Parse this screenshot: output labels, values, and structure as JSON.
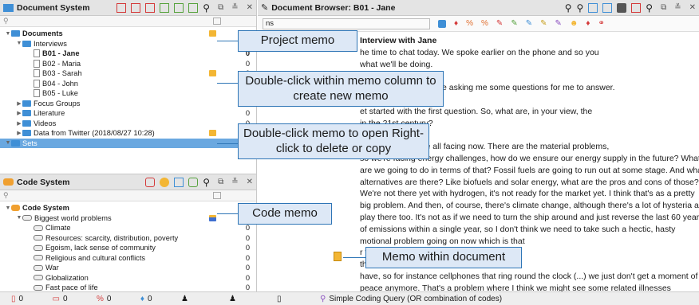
{
  "document_system": {
    "title": "Document System",
    "tree": [
      {
        "label": "Documents",
        "bold": true,
        "level": 0,
        "icon": "folder",
        "memo": true
      },
      {
        "label": "Interviews",
        "level": 1,
        "icon": "folder"
      },
      {
        "label": "B01 - Jane",
        "level": 2,
        "icon": "doc",
        "bold": true,
        "count": "0"
      },
      {
        "label": "B02 - Maria",
        "level": 2,
        "icon": "doc",
        "count": "0"
      },
      {
        "label": "B03 - Sarah",
        "level": 2,
        "icon": "doc",
        "count": "0",
        "memo": true
      },
      {
        "label": "B04 - John",
        "level": 2,
        "icon": "doc",
        "count": "0"
      },
      {
        "label": "B05 - Luke",
        "level": 2,
        "icon": "doc",
        "count": "0"
      },
      {
        "label": "Focus Groups",
        "level": 1,
        "icon": "folder",
        "count": "0"
      },
      {
        "label": "Literature",
        "level": 1,
        "icon": "folder",
        "count": "0"
      },
      {
        "label": "Videos",
        "level": 1,
        "icon": "folder",
        "count": "0"
      },
      {
        "label": "Data from Twitter (2018/08/27 10:28)",
        "level": 1,
        "icon": "folder",
        "count": "0",
        "memo": true
      },
      {
        "label": "Sets",
        "level": 0,
        "icon": "folder",
        "selected": true,
        "count": "0"
      }
    ]
  },
  "code_system": {
    "title": "Code System",
    "tree": [
      {
        "label": "Code System",
        "bold": true,
        "level": 0,
        "icon": "folder"
      },
      {
        "label": "Biggest world problems",
        "level": 1,
        "icon": "code",
        "memo": true
      },
      {
        "label": "Climate",
        "level": 2,
        "icon": "code",
        "count": "0"
      },
      {
        "label": "Resources: scarcity, distribution, poverty",
        "level": 2,
        "icon": "code",
        "count": "0"
      },
      {
        "label": "Egoism, lack sense of community",
        "level": 2,
        "icon": "code",
        "count": "0"
      },
      {
        "label": "Religious and cultural conflicts",
        "level": 2,
        "icon": "code",
        "count": "0"
      },
      {
        "label": "War",
        "level": 2,
        "icon": "code",
        "count": "0"
      },
      {
        "label": "Globalization",
        "level": 2,
        "icon": "code",
        "count": "0"
      },
      {
        "label": "Fast pace of life",
        "level": 2,
        "icon": "code",
        "count": "0"
      }
    ]
  },
  "document_browser": {
    "title": "Document Browser: B01 - Jane",
    "toolbar_field": "ns",
    "line_number": "1",
    "heading": "Interview with Jane",
    "lines": [
      "he time to chat today. We spoke earlier on the phone and so you",
      "what we'll be doing.",
      "",
      "g an interview. You'll be asking me some questions for me to answer.",
      "",
      "et started with the first question. So, what are, in your view, the",
      "in the 21st century?",
      "",
      "the problems we're all facing now. There are the material problems,",
      "so we're facing energy challenges, how do we ensure our energy supply in the future? What",
      "are we going to do in terms of that? Fossil fuels are going to run out at some stage. And what",
      "alternatives are there? Like biofuels and solar energy, what are the pros and cons of those?",
      "We're not there yet with hydrogen, it's not ready for the market yet. I think that's as a pretty",
      "big problem. And then, of course, there's climate change, although there's a lot of hysteria at",
      "play there too. It's not as if we need to turn the ship around and just reverse the last 60 years",
      "of emissions within a single year, so I don't think we need to take such a hectic, hasty",
      "motional problem going on now which is that",
      "r too little time for the important things in",
      "that. All the modern technology that we",
      "have, so for instance cellphones that ring round the clock (...) we just don't get a moment of",
      "peace anymore. That's a problem where I think we might see some related illnesses"
    ]
  },
  "status_bar": {
    "items": [
      "0",
      "0",
      "0",
      "0"
    ],
    "query": "Simple Coding Query (OR combination of codes)"
  },
  "callouts": {
    "project_memo": "Project memo",
    "double_click_create": "Double-click within memo column to create new memo",
    "double_click_open": "Double-click memo to open Right-click to delete or copy",
    "code_memo": "Code memo",
    "memo_within_doc": "Memo within document"
  }
}
